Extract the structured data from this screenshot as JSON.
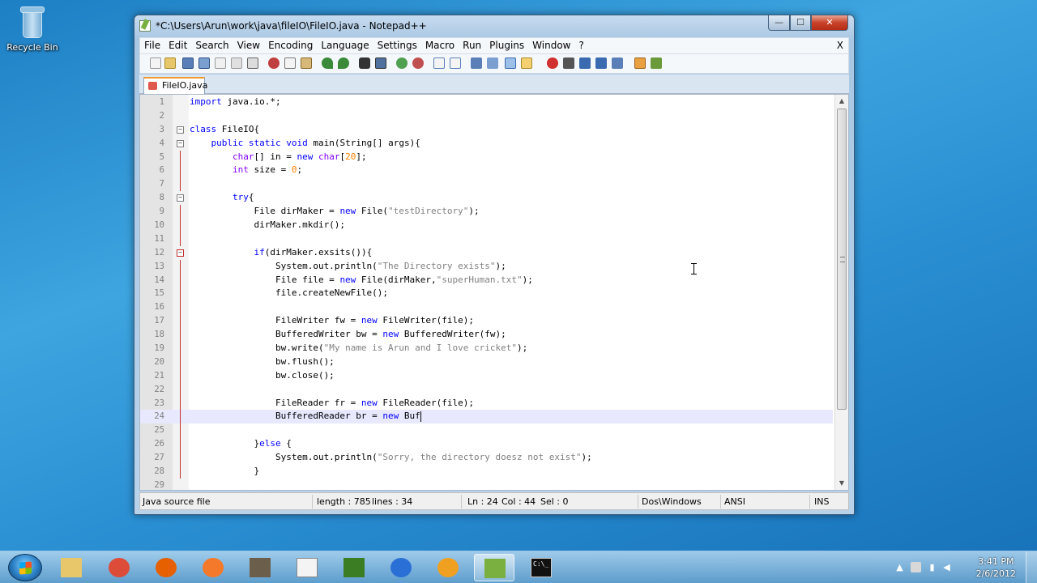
{
  "desktop": {
    "recycle_bin_label": "Recycle Bin"
  },
  "window": {
    "title": "*C:\\Users\\Arun\\work\\java\\fileIO\\FileIO.java - Notepad++",
    "min_glyph": "—",
    "max_glyph": "☐",
    "close_glyph": "✕"
  },
  "menubar": {
    "items": [
      "File",
      "Edit",
      "Search",
      "View",
      "Encoding",
      "Language",
      "Settings",
      "Macro",
      "Run",
      "Plugins",
      "Window",
      "?"
    ],
    "close_doc": "X"
  },
  "tab": {
    "label": "FileIO.java"
  },
  "editor": {
    "current_line": 24,
    "lines": [
      {
        "n": "1",
        "code": "import java.io.*;"
      },
      {
        "n": "2",
        "code": ""
      },
      {
        "n": "3",
        "code": "class FileIO{"
      },
      {
        "n": "4",
        "code": "    public static void main(String[] args){"
      },
      {
        "n": "5",
        "code": "        char[] in = new char[20];"
      },
      {
        "n": "6",
        "code": "        int size = 0;"
      },
      {
        "n": "7",
        "code": ""
      },
      {
        "n": "8",
        "code": "        try{"
      },
      {
        "n": "9",
        "code": "            File dirMaker = new File(\"testDirectory\");"
      },
      {
        "n": "10",
        "code": "            dirMaker.mkdir();"
      },
      {
        "n": "11",
        "code": ""
      },
      {
        "n": "12",
        "code": "            if(dirMaker.exsits()){"
      },
      {
        "n": "13",
        "code": "                System.out.println(\"The Directory exists\");"
      },
      {
        "n": "14",
        "code": "                File file = new File(dirMaker,\"superHuman.txt\");"
      },
      {
        "n": "15",
        "code": "                file.createNewFile();"
      },
      {
        "n": "16",
        "code": ""
      },
      {
        "n": "17",
        "code": "                FileWriter fw = new FileWriter(file);"
      },
      {
        "n": "18",
        "code": "                BufferedWriter bw = new BufferedWriter(fw);"
      },
      {
        "n": "19",
        "code": "                bw.write(\"My name is Arun and I love cricket\");"
      },
      {
        "n": "20",
        "code": "                bw.flush();"
      },
      {
        "n": "21",
        "code": "                bw.close();"
      },
      {
        "n": "22",
        "code": ""
      },
      {
        "n": "23",
        "code": "                FileReader fr = new FileReader(file);"
      },
      {
        "n": "24",
        "code": "                BufferedReader br = new Buf"
      },
      {
        "n": "25",
        "code": ""
      },
      {
        "n": "26",
        "code": "            }else {"
      },
      {
        "n": "27",
        "code": "                System.out.println(\"Sorry, the directory doesz not exist\");"
      },
      {
        "n": "28",
        "code": "            }"
      },
      {
        "n": "29",
        "code": ""
      }
    ],
    "fold_markers": [
      3,
      4,
      8,
      12
    ]
  },
  "statusbar": {
    "language": "Java source file",
    "length": "length : 785",
    "lines": "lines : 34",
    "ln": "Ln : 24",
    "col": "Col : 44",
    "sel": "Sel : 0",
    "eol": "Dos\\Windows",
    "encoding": "ANSI",
    "mode": "INS"
  },
  "taskbar": {
    "apps": [
      {
        "name": "explorer-taskbar-button",
        "icon": "folder-icon",
        "color": "#e8c66a"
      },
      {
        "name": "chrome-taskbar-button",
        "icon": "chrome-icon",
        "color": "#dd4b39"
      },
      {
        "name": "firefox-taskbar-button",
        "icon": "firefox-icon",
        "color": "#e66000"
      },
      {
        "name": "blender-taskbar-button",
        "icon": "blender-icon",
        "color": "#f5792a"
      },
      {
        "name": "gimp-taskbar-button",
        "icon": "gimp-icon",
        "color": "#6b5f4b"
      },
      {
        "name": "document-taskbar-button",
        "icon": "document-icon",
        "color": "#f4f4f4"
      },
      {
        "name": "inkscape-taskbar-button",
        "icon": "inkscape-icon",
        "color": "#3a7d22"
      },
      {
        "name": "google-earth-taskbar-button",
        "icon": "globe-icon",
        "color": "#2a6fd6"
      },
      {
        "name": "pinwheel-taskbar-button",
        "icon": "pinwheel-icon",
        "color": "#f0a020"
      },
      {
        "name": "notepadpp-taskbar-button",
        "icon": "notepadpp-icon",
        "color": "#7ab040"
      },
      {
        "name": "cmd-taskbar-button",
        "icon": "terminal-icon",
        "color": "#111111"
      }
    ],
    "cmd_icon_text": "C:\\_",
    "tray_arrow": "▲",
    "time": "3:41 PM",
    "date": "2/6/2012"
  }
}
